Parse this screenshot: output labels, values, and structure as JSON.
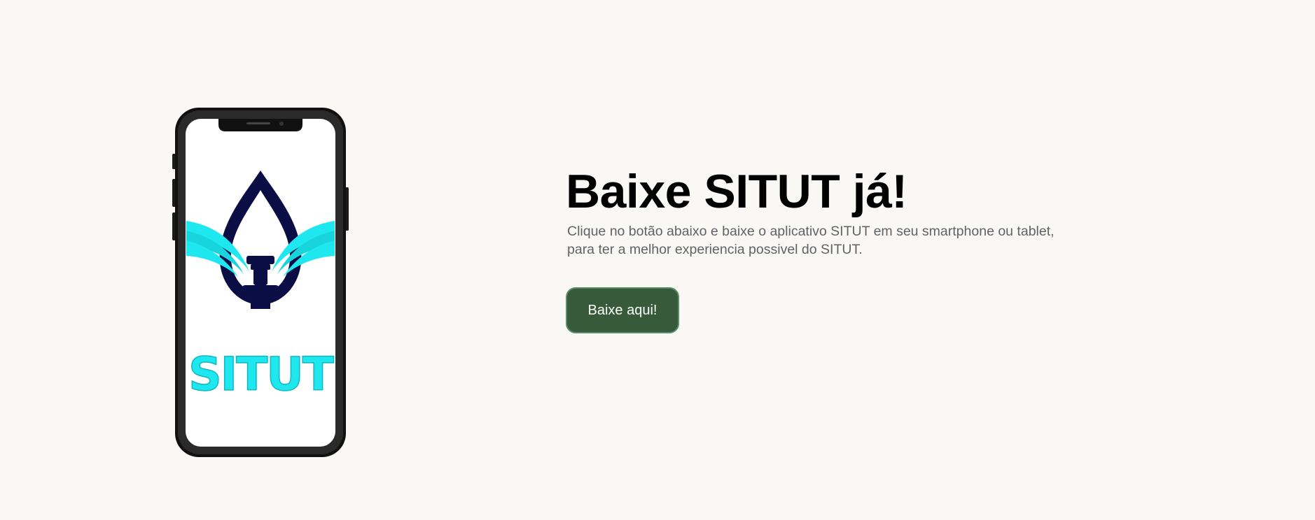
{
  "phone": {
    "logo_text": "SITUT"
  },
  "main": {
    "title": "Baixe SITUT já!",
    "description_line1": "Clique no botão abaixo e baixe o aplicativo SITUT em seu smartphone ou tablet,",
    "description_line2": "para ter a melhor experiencia possivel do SITUT.",
    "button_label": "Baixe aqui!"
  },
  "colors": {
    "background": "#f9f8f5",
    "button": "#365a3a",
    "logo_navy": "#0b0d45",
    "logo_cyan": "#1ee7ef"
  }
}
